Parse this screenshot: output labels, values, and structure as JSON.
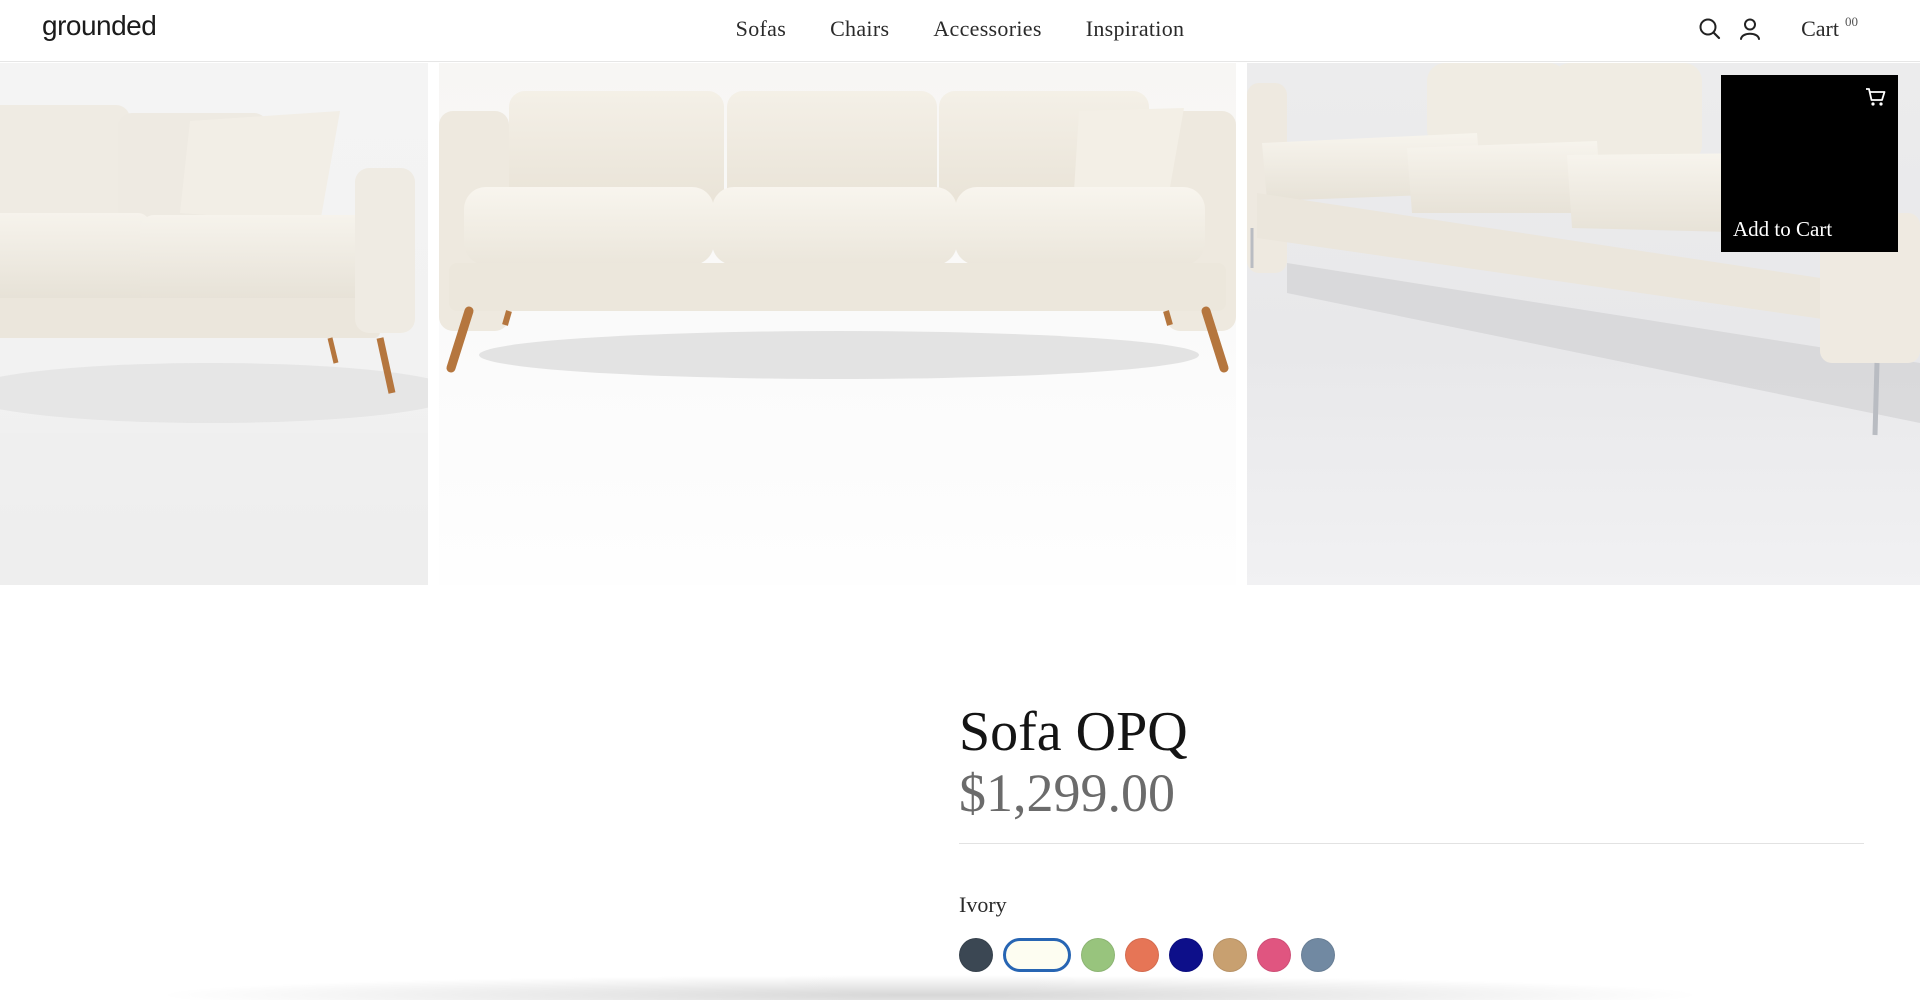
{
  "brand": {
    "logo": "grounded"
  },
  "nav": {
    "items": [
      "Sofas",
      "Chairs",
      "Accessories",
      "Inspiration"
    ]
  },
  "header": {
    "search_icon": "search-icon",
    "account_icon": "user-icon",
    "cart_label": "Cart",
    "cart_count": "00"
  },
  "gallery": {
    "images": [
      "sofa-side-view-image",
      "sofa-front-view-image",
      "sofa-angled-view-image"
    ],
    "add_to_cart_label": "Add to Cart",
    "cart_icon": "cart-icon"
  },
  "product": {
    "title": "Sofa OPQ",
    "price": "$1,299.00",
    "selected_color": "Ivory",
    "swatches": [
      {
        "color": "#3b4753",
        "selected": false
      },
      {
        "color": "#fdfdf1",
        "selected": true
      },
      {
        "color": "#98c47d",
        "selected": false
      },
      {
        "color": "#e67556",
        "selected": false
      },
      {
        "color": "#0d0f8a",
        "selected": false
      },
      {
        "color": "#c8a070",
        "selected": false
      },
      {
        "color": "#e05580",
        "selected": false
      },
      {
        "color": "#7189a2",
        "selected": false
      }
    ]
  },
  "colors": {
    "accent_selected": "#2765b3",
    "price": "#6b6b6b",
    "button_bg": "#000000"
  }
}
